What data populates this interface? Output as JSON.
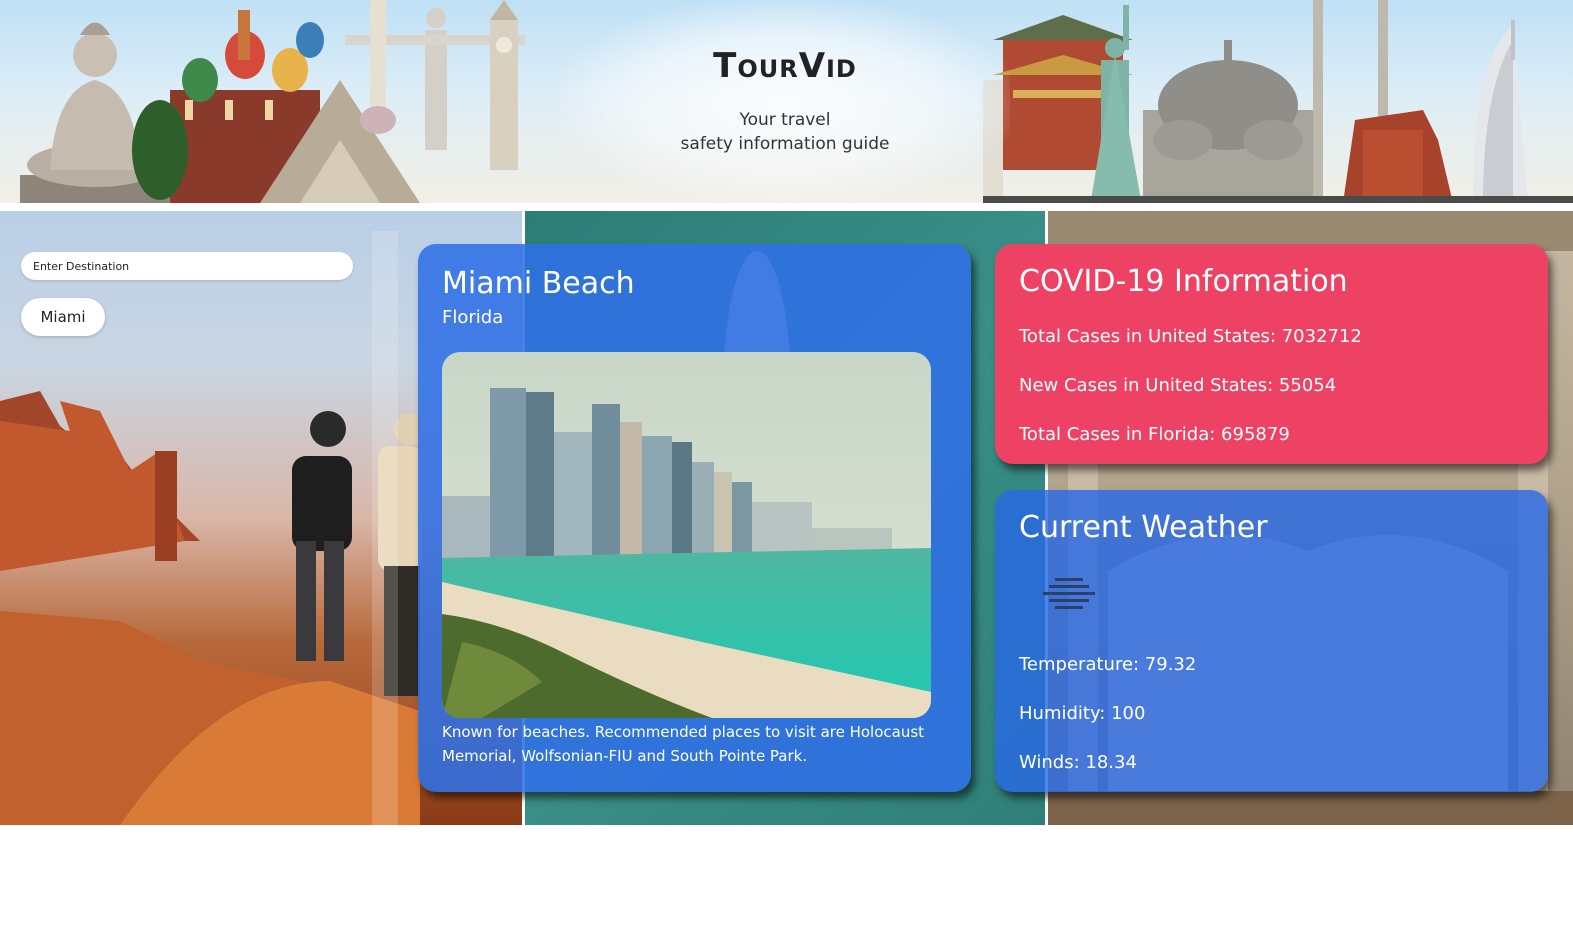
{
  "header": {
    "brand": "TourVid",
    "tagline_line1": "Your travel",
    "tagline_line2": "safety information guide"
  },
  "search": {
    "placeholder": "Enter Destination",
    "value": "",
    "city_button_label": "Miami"
  },
  "destination": {
    "name": "Miami Beach",
    "state": "Florida",
    "description": "Known for beaches. Recommended places to visit are Holocaust Memorial, Wolfsonian-FIU and South Pointe Park."
  },
  "covid": {
    "title": "COVID-19 Information",
    "total_cases_us": "Total Cases in United States: 7032712",
    "new_cases_us": "New Cases in United States: 55054",
    "total_cases_state": "Total Cases in Florida: 695879"
  },
  "weather": {
    "title": "Current Weather",
    "icon": "mist-icon",
    "temperature": "Temperature: 79.32",
    "humidity": "Humidity: 100",
    "winds": "Winds: 18.34"
  },
  "colors": {
    "covid_card": "#ee4264",
    "blue_card": "#2f6fe6"
  }
}
